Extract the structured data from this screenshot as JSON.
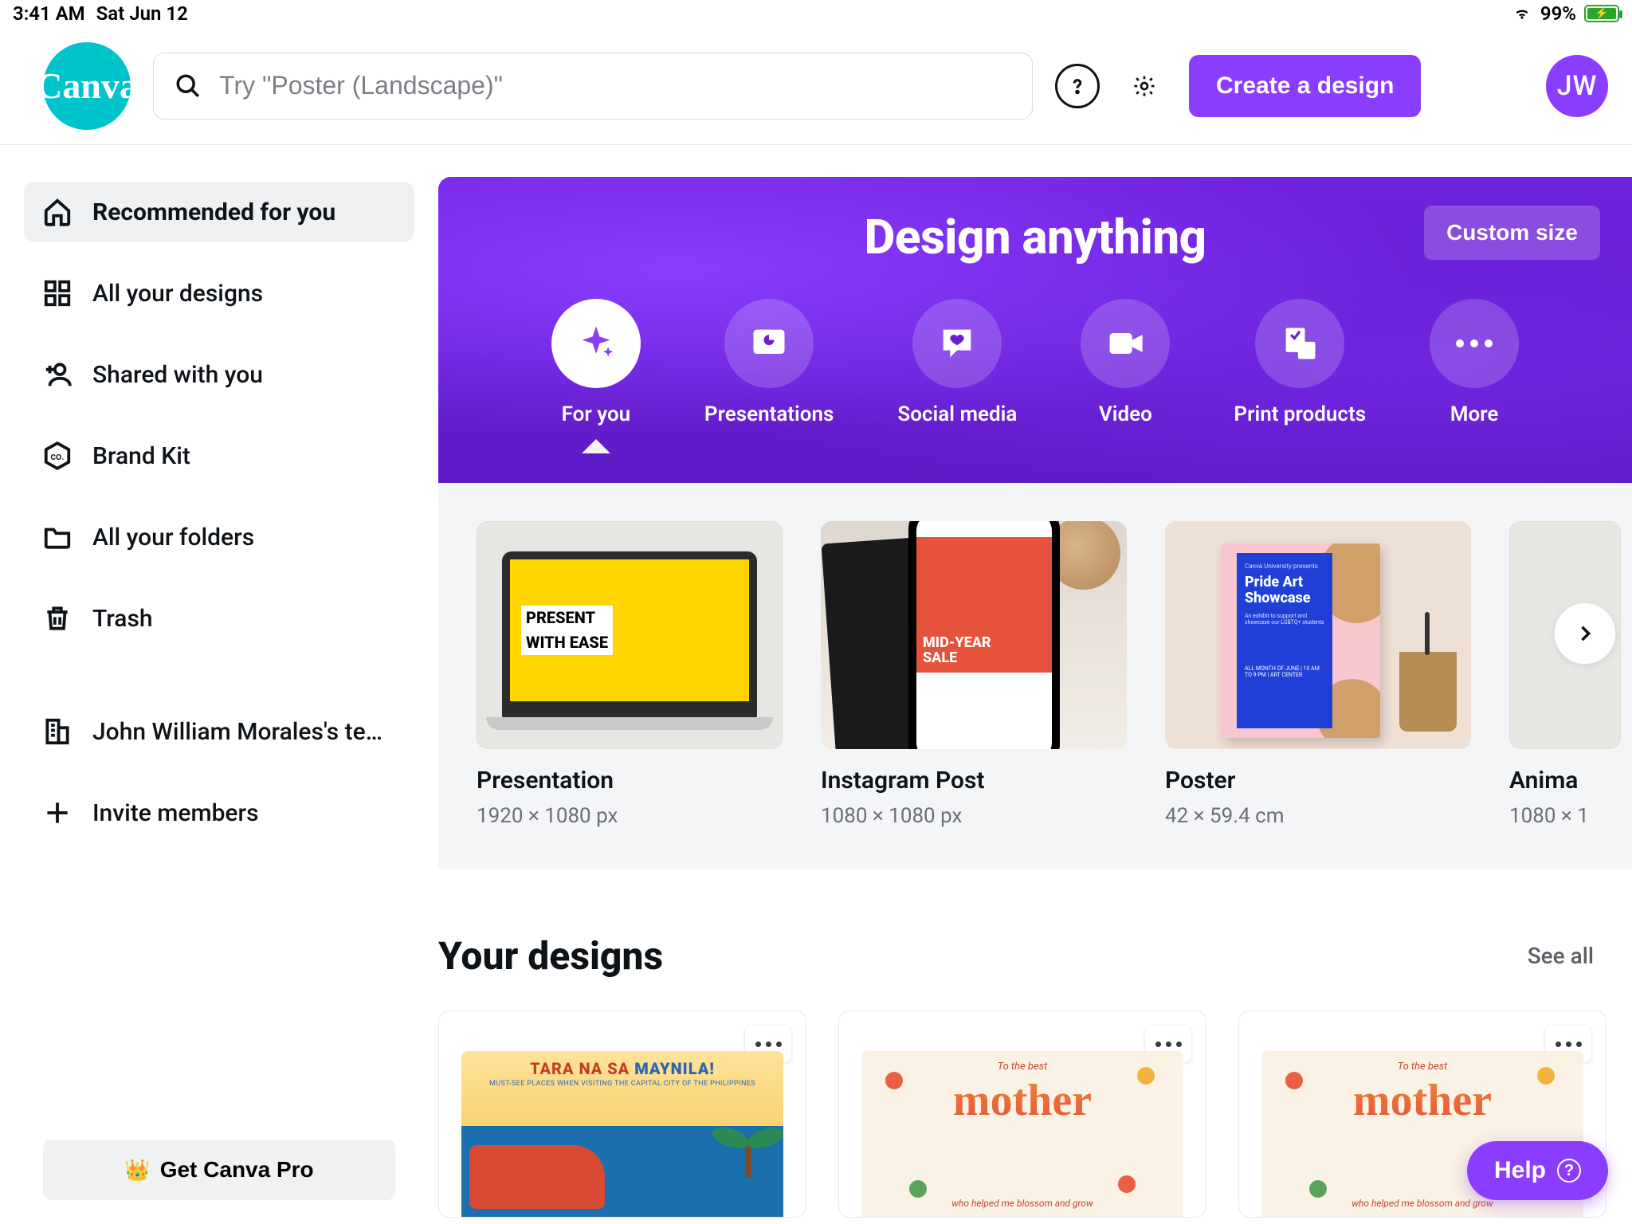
{
  "status": {
    "time": "3:41 AM",
    "date": "Sat Jun 12",
    "battery": "99%"
  },
  "header": {
    "logo_text": "Canva",
    "search_placeholder": "Try \"Poster (Landscape)\"",
    "create_label": "Create a design",
    "avatar_initials": "JW"
  },
  "sidebar": {
    "items": [
      {
        "label": "Recommended for you",
        "icon": "home-icon",
        "active": true
      },
      {
        "label": "All your designs",
        "icon": "grid-icon"
      },
      {
        "label": "Shared with you",
        "icon": "people-plus-icon"
      },
      {
        "label": "Brand Kit",
        "icon": "co-badge-icon"
      },
      {
        "label": "All your folders",
        "icon": "folder-icon"
      },
      {
        "label": "Trash",
        "icon": "trash-icon"
      }
    ],
    "team_label": "John William Morales's tea…",
    "invite_label": "Invite members",
    "pro_label": "Get Canva Pro"
  },
  "hero": {
    "title": "Design anything",
    "custom_size": "Custom size",
    "tabs": [
      {
        "label": "For you",
        "icon": "sparkle-icon",
        "active": true
      },
      {
        "label": "Presentations",
        "icon": "presentation-icon"
      },
      {
        "label": "Social media",
        "icon": "heart-bubble-icon"
      },
      {
        "label": "Video",
        "icon": "video-icon"
      },
      {
        "label": "Print products",
        "icon": "print-icon"
      },
      {
        "label": "More",
        "icon": "more-icon"
      }
    ]
  },
  "templates": [
    {
      "title": "Presentation",
      "dimensions": "1920 × 1080 px",
      "thumb_text1": "PRESENT",
      "thumb_text2": "WITH EASE"
    },
    {
      "title": "Instagram Post",
      "dimensions": "1080 × 1080 px",
      "thumb_text1": "MID-YEAR",
      "thumb_text2": "SALE"
    },
    {
      "title": "Poster",
      "dimensions": "42 × 59.4 cm",
      "thumb_text1": "Pride Art",
      "thumb_text2": "Showcase"
    },
    {
      "title": "Anima",
      "dimensions": "1080 × 1"
    }
  ],
  "your_designs": {
    "heading": "Your designs",
    "see_all": "See all",
    "cards": [
      {
        "kind": "manila",
        "line1": "TARA NA SA",
        "line1b": "MAYNILA!",
        "sub": "MUST-SEE PLACES WHEN VISITING THE CAPITAL CITY OF THE PHILIPPINES"
      },
      {
        "kind": "mother",
        "top": "To the best",
        "main": "mother",
        "bottom": "who helped me blossom and grow"
      },
      {
        "kind": "mother",
        "top": "To the best",
        "main": "mother",
        "bottom": "who helped me blossom and grow"
      }
    ]
  },
  "help_label": "Help"
}
